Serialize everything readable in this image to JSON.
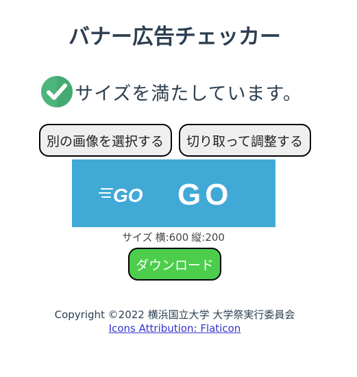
{
  "page": {
    "title": "バナー広告チェッカー"
  },
  "status": {
    "message": "サイズを満たしています。",
    "icon": "check-circle-icon",
    "icon_color": "#48b07a"
  },
  "buttons": {
    "select_image": "別の画像を選択する",
    "crop_adjust": "切り取って調整する",
    "download": "ダウンロード"
  },
  "banner": {
    "background_color": "#41a9d6",
    "logo_text": "GO",
    "main_text": "GO"
  },
  "size_info": {
    "label": "サイズ",
    "width": "横:600",
    "height": "縦:200"
  },
  "footer": {
    "copyright": "Copyright ©2022 横浜国立大学 大学祭実行委員会",
    "attribution_link": "Icons Attribution: Flaticon"
  },
  "colors": {
    "download_button": "#4cce4c",
    "title_text": "#2c3e50",
    "link": "#3333cc"
  }
}
